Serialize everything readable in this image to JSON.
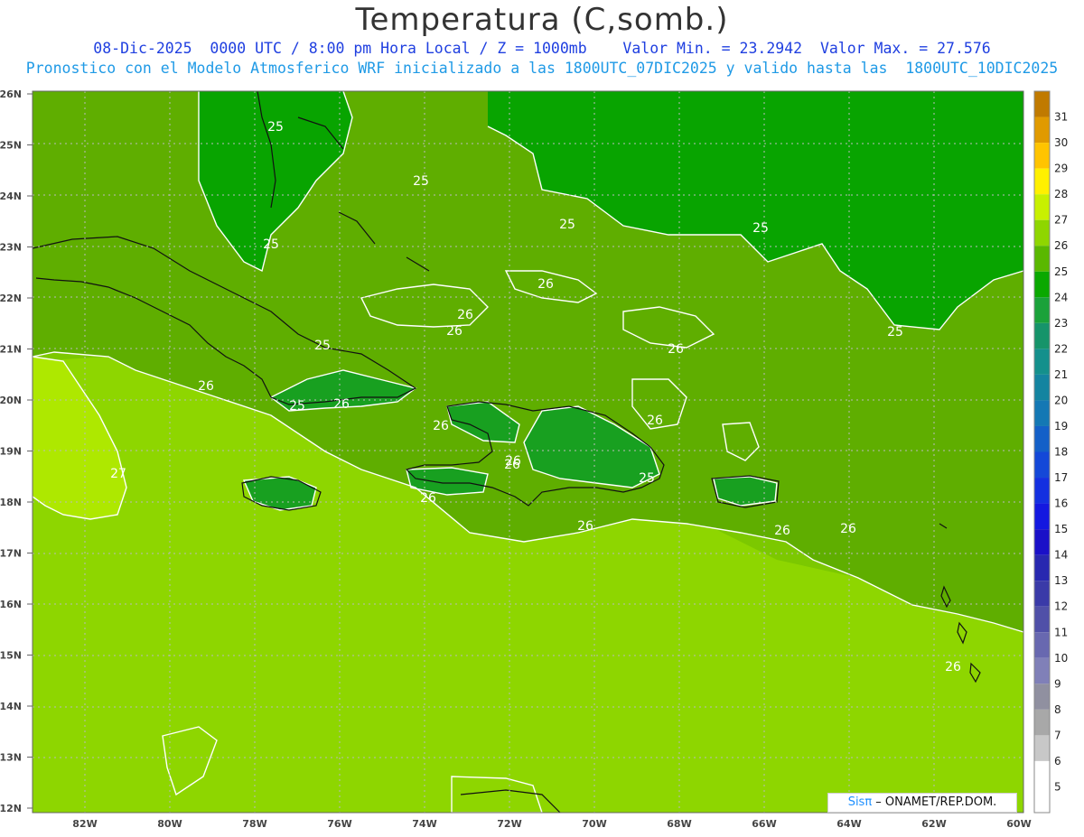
{
  "header": {
    "title": "Temperatura (C,somb.)",
    "line1": "08-Dic-2025  0000 UTC / 8:00 pm Hora Local / Z = 1000mb    Valor Min. = 23.2942  Valor Max. = 27.576",
    "line2": "Pronostico con el Modelo Atmosferico WRF inicializado a las 1800UTC_07DIC2025 y valido hasta las  1800UTC_10DIC2025"
  },
  "axes": {
    "lat_labels": [
      "26N",
      "25N",
      "24N",
      "23N",
      "22N",
      "21N",
      "20N",
      "19N",
      "18N",
      "17N",
      "16N",
      "15N",
      "14N",
      "13N",
      "12N"
    ],
    "lon_labels": [
      "82W",
      "80W",
      "78W",
      "76W",
      "74W",
      "72W",
      "70W",
      "68W",
      "66W",
      "64W",
      "62W",
      "60W"
    ]
  },
  "colorbar": {
    "levels": [
      "31",
      "30",
      "29",
      "28",
      "27",
      "26",
      "25",
      "24",
      "23",
      "22",
      "21",
      "20",
      "19",
      "18",
      "17",
      "16",
      "15",
      "14",
      "13",
      "12",
      "11",
      "10",
      "9",
      "8",
      "7",
      "6",
      "5"
    ],
    "colors": [
      "#c07a00",
      "#e09a00",
      "#ffc400",
      "#fff000",
      "#c8f000",
      "#8fd600",
      "#5ab800",
      "#0aa800",
      "#1aa23a",
      "#16946a",
      "#14908c",
      "#1484a0",
      "#1478b4",
      "#1460c8",
      "#1448d8",
      "#1430e0",
      "#1418e0",
      "#1a10c8",
      "#2828b0",
      "#3a3aa8",
      "#5050a8",
      "#6868b0",
      "#8080b8",
      "#9090a0",
      "#a8a8a8",
      "#c8c8c8",
      "#ffffff"
    ]
  },
  "contour_labels": [
    {
      "text": "25"
    },
    {
      "text": "25"
    },
    {
      "text": "25"
    },
    {
      "text": "25"
    },
    {
      "text": "25"
    },
    {
      "text": "25"
    },
    {
      "text": "26"
    },
    {
      "text": "26"
    },
    {
      "text": "26"
    },
    {
      "text": "26"
    },
    {
      "text": "26"
    },
    {
      "text": "26"
    },
    {
      "text": "26"
    },
    {
      "text": "26"
    },
    {
      "text": "25"
    },
    {
      "text": "25"
    },
    {
      "text": "26"
    },
    {
      "text": "26"
    },
    {
      "text": "26"
    },
    {
      "text": "26"
    },
    {
      "text": "26"
    },
    {
      "text": "26"
    },
    {
      "text": "27"
    },
    {
      "text": "25"
    },
    {
      "text": "26"
    }
  ],
  "credit": {
    "brand": "Sisπ",
    "text": " – ONAMET/REP.DOM."
  }
}
